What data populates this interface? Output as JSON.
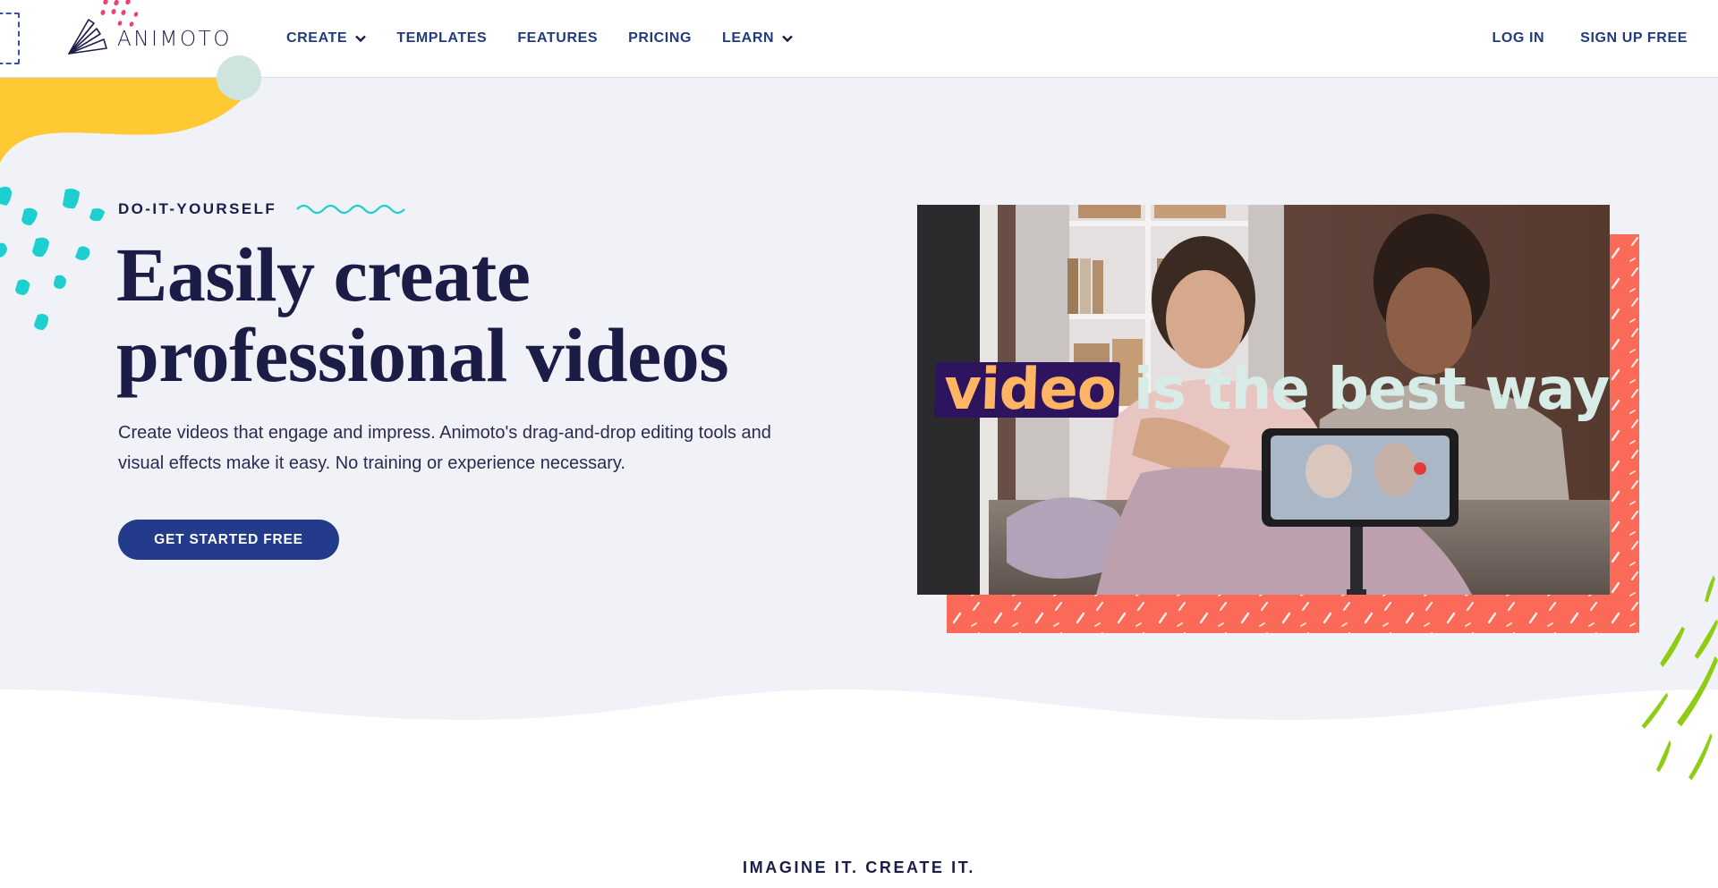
{
  "brand": {
    "name": "ANIMOTO",
    "colors": {
      "navy": "#1b1d47",
      "nav_blue": "#233b7d",
      "cta_blue": "#233b8a",
      "coral": "#fb6a58",
      "yellow": "#ffc933",
      "teal": "#1ecfcf",
      "pink": "#f03e78",
      "lime": "#8fcc14",
      "hero_bg": "#f1f1f8"
    }
  },
  "nav": {
    "items": [
      {
        "label": "CREATE",
        "has_dropdown": true,
        "icon": "chevron-down-icon"
      },
      {
        "label": "TEMPLATES",
        "has_dropdown": false
      },
      {
        "label": "FEATURES",
        "has_dropdown": false
      },
      {
        "label": "PRICING",
        "has_dropdown": false
      },
      {
        "label": "LEARN",
        "has_dropdown": true,
        "icon": "chevron-down-icon"
      }
    ],
    "login_label": "LOG IN",
    "signup_label": "SIGN UP FREE"
  },
  "hero": {
    "eyebrow": "DO-IT-YOURSELF",
    "headline_line1": "Easily create",
    "headline_line2": "professional videos",
    "subtext_line1": "Create videos that engage and impress. Animoto's drag-and-drop editing tools and",
    "subtext_line2": "visual effects make it easy. No training or experience necessary.",
    "cta_label": "GET STARTED FREE",
    "video": {
      "caption_highlight": "video",
      "caption_rest": "is the best way"
    }
  },
  "next_section": {
    "label": "IMAGINE IT. CREATE IT."
  }
}
